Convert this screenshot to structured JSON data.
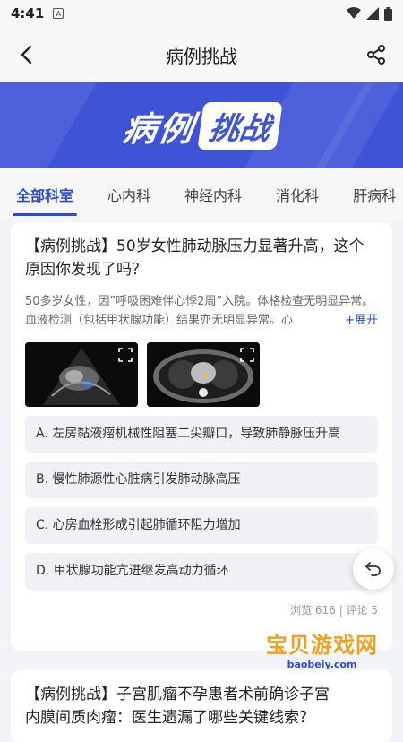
{
  "status": {
    "time": "4:41",
    "sim_icon": "A"
  },
  "nav": {
    "title": "病例挑战"
  },
  "banner": {
    "text_left": "病例",
    "text_right": "挑战"
  },
  "tabs": [
    "全部科室",
    "心内科",
    "神经内科",
    "消化科",
    "肝病科"
  ],
  "card1": {
    "title": "【病例挑战】50岁女性肺动脉压力显著升高，这个原因你发现了吗？",
    "desc": "50多岁女性，因”呼吸困难伴心悸2周”入院。体格检查无明显异常。血液检测（包括甲状腺功能）结果亦无明显异常。心",
    "expand": "+展开",
    "options": [
      "A. 左房黏液瘤机械性阻塞二尖瓣口，导致肺静脉压升高",
      "B. 慢性肺源性心脏病引发肺动脉高压",
      "C. 心房血栓形成引起肺循环阻力增加",
      "D. 甲状腺功能亢进继发高动力循环"
    ],
    "meta": "浏览 616 | 评论 5"
  },
  "card2": {
    "title": "【病例挑战】子宫肌瘤不孕患者术前确诊子宫",
    "title2": "内膜间质肉瘤：医生遗漏了哪些关键线索？"
  },
  "watermark": {
    "main": "宝贝游戏网",
    "sub": "baobeiy.com"
  },
  "colors": {
    "accent": "#2e4bd6",
    "banner": "#3f53d7"
  }
}
